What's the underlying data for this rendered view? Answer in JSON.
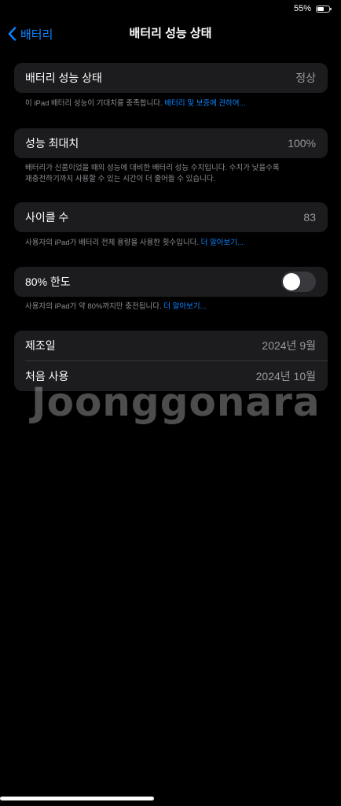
{
  "status_bar": {
    "battery_percent_label": "55%",
    "battery_level": 0.55
  },
  "nav": {
    "back_label": "배터리",
    "title": "배터리 성능 상태"
  },
  "battery_health": {
    "label": "배터리 성능 상태",
    "value": "정상",
    "footer_text": "이 iPad 배터리 성능이 기대치를 충족합니다. ",
    "footer_link": "배터리 및 보증에 관하여..."
  },
  "max_capacity": {
    "label": "성능 최대치",
    "value": "100%",
    "footer_line1": "배터리가 신품이었을 때의 성능에 대비한 배터리 성능 수치입니다. 수치가 낮을수록",
    "footer_line2": "재충전하기까지 사용할 수 있는 시간이 더 줄어들 수 있습니다."
  },
  "cycle_count": {
    "label": "사이클 수",
    "value": "83",
    "footer_text": "사용자의 iPad가 배터리 전체 용량을 사용한 횟수입니다. ",
    "footer_link": "더 알아보기..."
  },
  "limit_80": {
    "label": "80% 한도",
    "enabled": false,
    "footer_text": "사용자의 iPad가 약 80%까지만 충전됩니다. ",
    "footer_link": "더 알아보기..."
  },
  "dates": {
    "manufacture_label": "제조일",
    "manufacture_value": "2024년 9월",
    "first_use_label": "처음 사용",
    "first_use_value": "2024년 10월"
  },
  "watermark": "Joonggonara",
  "colors": {
    "accent": "#0a84ff",
    "cell_background": "#1c1c1e",
    "secondary_text": "#8e8e93"
  }
}
